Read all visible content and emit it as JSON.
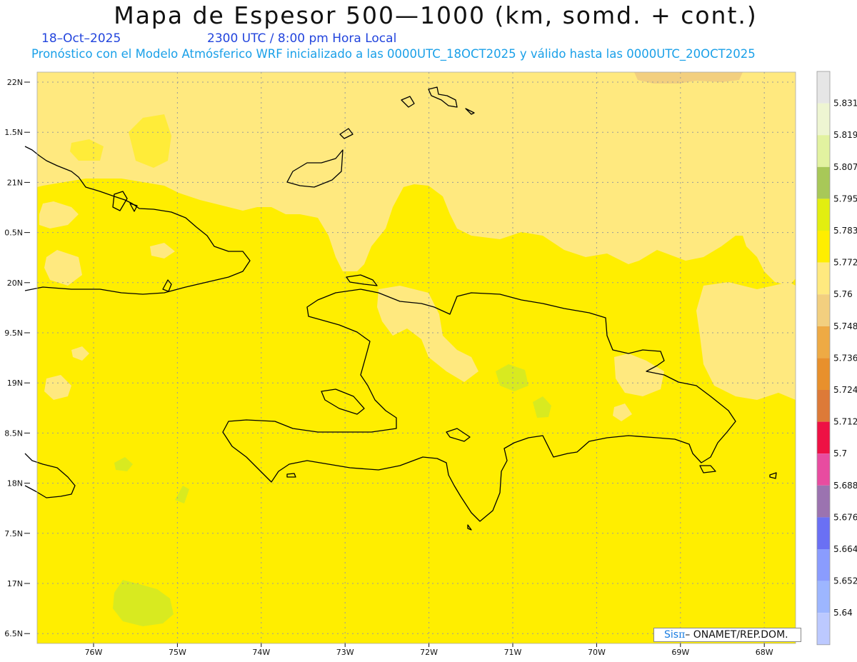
{
  "header": {
    "title": "Mapa de Espesor 500—1000 (km, somd. + cont.)",
    "date": "18–Oct–2025",
    "utc": "2300 UTC / 8:00 pm Hora Local",
    "subtitle": "Pronóstico con el Modelo Atmósferico WRF inicializado a las 0000UTC_18OCT2025 y válido hasta las  0000UTC_20OCT2025"
  },
  "map": {
    "lat_labels": [
      "22N",
      "1.5N",
      "21N",
      "0.5N",
      "20N",
      "9.5N",
      "19N",
      "8.5N",
      "18N",
      "7.5N",
      "17N",
      "6.5N"
    ],
    "lon_labels": [
      "76W",
      "75W",
      "74W",
      "73W",
      "72W",
      "71W",
      "70W",
      "69W",
      "68W"
    ],
    "colors": {
      "base_yellow": "#ffee00",
      "light_yellow": "#ffe97f",
      "tan": "#f2cf7f",
      "light_green": "#d8ea20",
      "coastline": "#000000"
    }
  },
  "colorbar": {
    "labels": [
      "5.831",
      "5.819",
      "5.807",
      "5.795",
      "5.783",
      "5.772",
      "5.76",
      "5.748",
      "5.736",
      "5.724",
      "5.712",
      "5.7",
      "5.688",
      "5.676",
      "5.664",
      "5.652",
      "5.64"
    ],
    "colors": [
      "#e6e6e6",
      "#eef5d2",
      "#e2f2a0",
      "#a8c858",
      "#e2ee10",
      "#ffee00",
      "#ffe97f",
      "#f2cf7f",
      "#eeaa44",
      "#e8902c",
      "#dd7a38",
      "#ee1144",
      "#e84ca0",
      "#9b73b0",
      "#6a70f4",
      "#8a9cfe",
      "#9db6ff",
      "#bcc9ff"
    ]
  },
  "credit": {
    "sis": "Sis",
    "pi": "π",
    "text": "– ONAMET/REP.DOM."
  }
}
